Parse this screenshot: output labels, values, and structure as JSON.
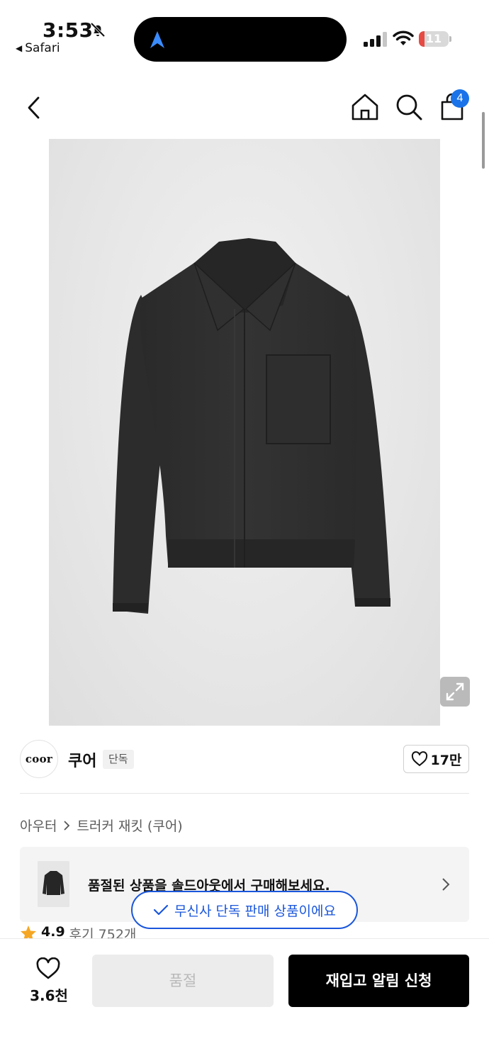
{
  "status_bar": {
    "time": "3:53",
    "back_app": "Safari",
    "battery": "11",
    "battery_level": 0.11
  },
  "header": {
    "icons": [
      "back-icon",
      "home-icon",
      "search-icon",
      "shopping-bag-icon"
    ],
    "cart_badge": "4"
  },
  "product": {
    "image_icon": "jacket-image",
    "expand_icon": "expand-icon"
  },
  "brand": {
    "logo_text": "coor",
    "name": "쿠어",
    "tag": "단독",
    "likes": "17만"
  },
  "breadcrumb": {
    "category": "아우터",
    "subcategory": "트러커 재킷 (쿠어)"
  },
  "banner": {
    "text": "품절된 상품을 솔드아웃에서 구매해보세요."
  },
  "exclusive_notice": {
    "text": "무신사 단독 판매 상품이에요"
  },
  "rating": {
    "value": "4.9",
    "reviews": "후기 752개"
  },
  "bottom_bar": {
    "wish_count": "3.6천",
    "soldout_label": "품절",
    "restock_label": "재입고 알림 신청"
  },
  "colors": {
    "accent_blue": "#1a56db",
    "badge_blue": "#1a73e8",
    "star": "#f5a623",
    "battery_low": "#e64a42"
  }
}
